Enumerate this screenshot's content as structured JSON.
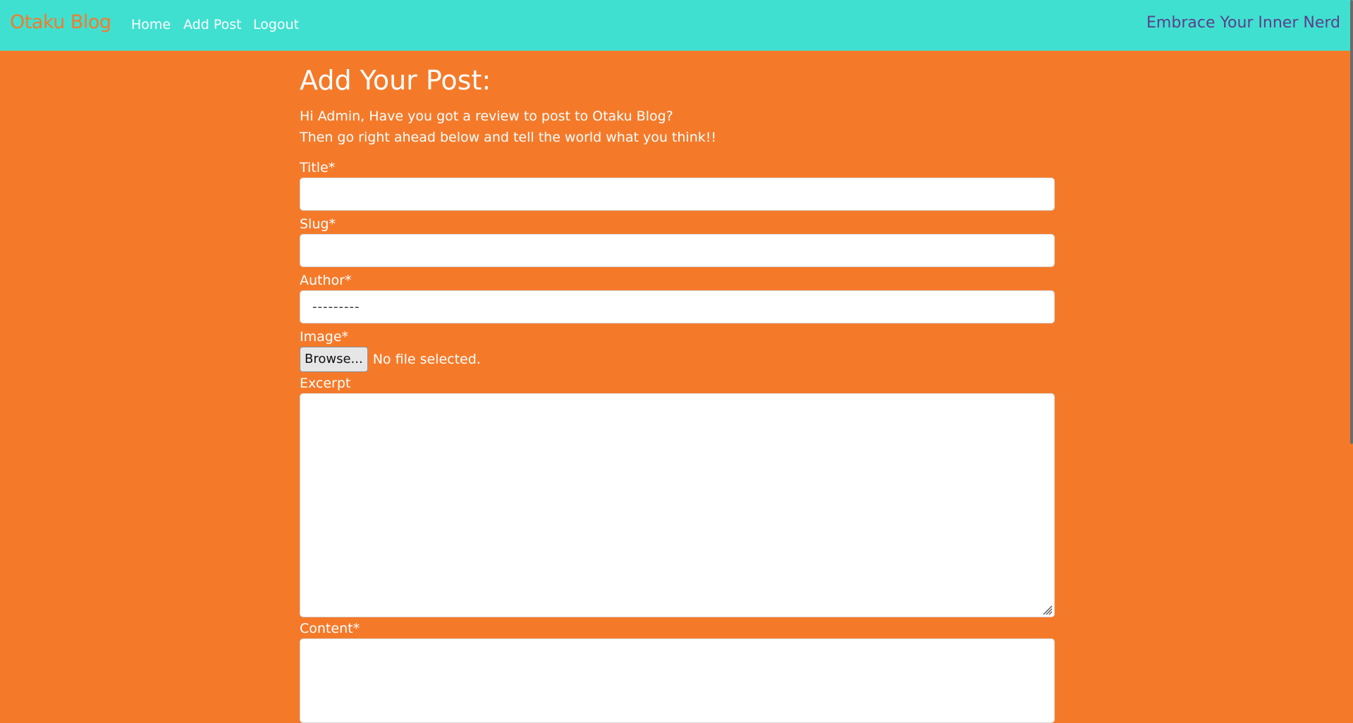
{
  "navbar": {
    "brand": "Otaku Blog",
    "links": [
      "Home",
      "Add Post",
      "Logout"
    ],
    "tagline": "Embrace Your Inner Nerd"
  },
  "main": {
    "title": "Add Your Post:",
    "intro_line1": "Hi Admin, Have you got a review to post to Otaku Blog?",
    "intro_line2": "Then go right ahead below and tell the world what you think!!"
  },
  "form": {
    "title_label": "Title*",
    "title_value": "",
    "slug_label": "Slug*",
    "slug_value": "",
    "author_label": "Author*",
    "author_selected": "---------",
    "image_label": "Image*",
    "browse_label": "Browse...",
    "file_status": "No file selected.",
    "excerpt_label": "Excerpt",
    "content_label": "Content*"
  },
  "colors": {
    "navbar_bg": "#40e0d0",
    "page_bg": "#f47a2a",
    "brand": "#f47a2a",
    "tagline": "#5b3f8a"
  }
}
